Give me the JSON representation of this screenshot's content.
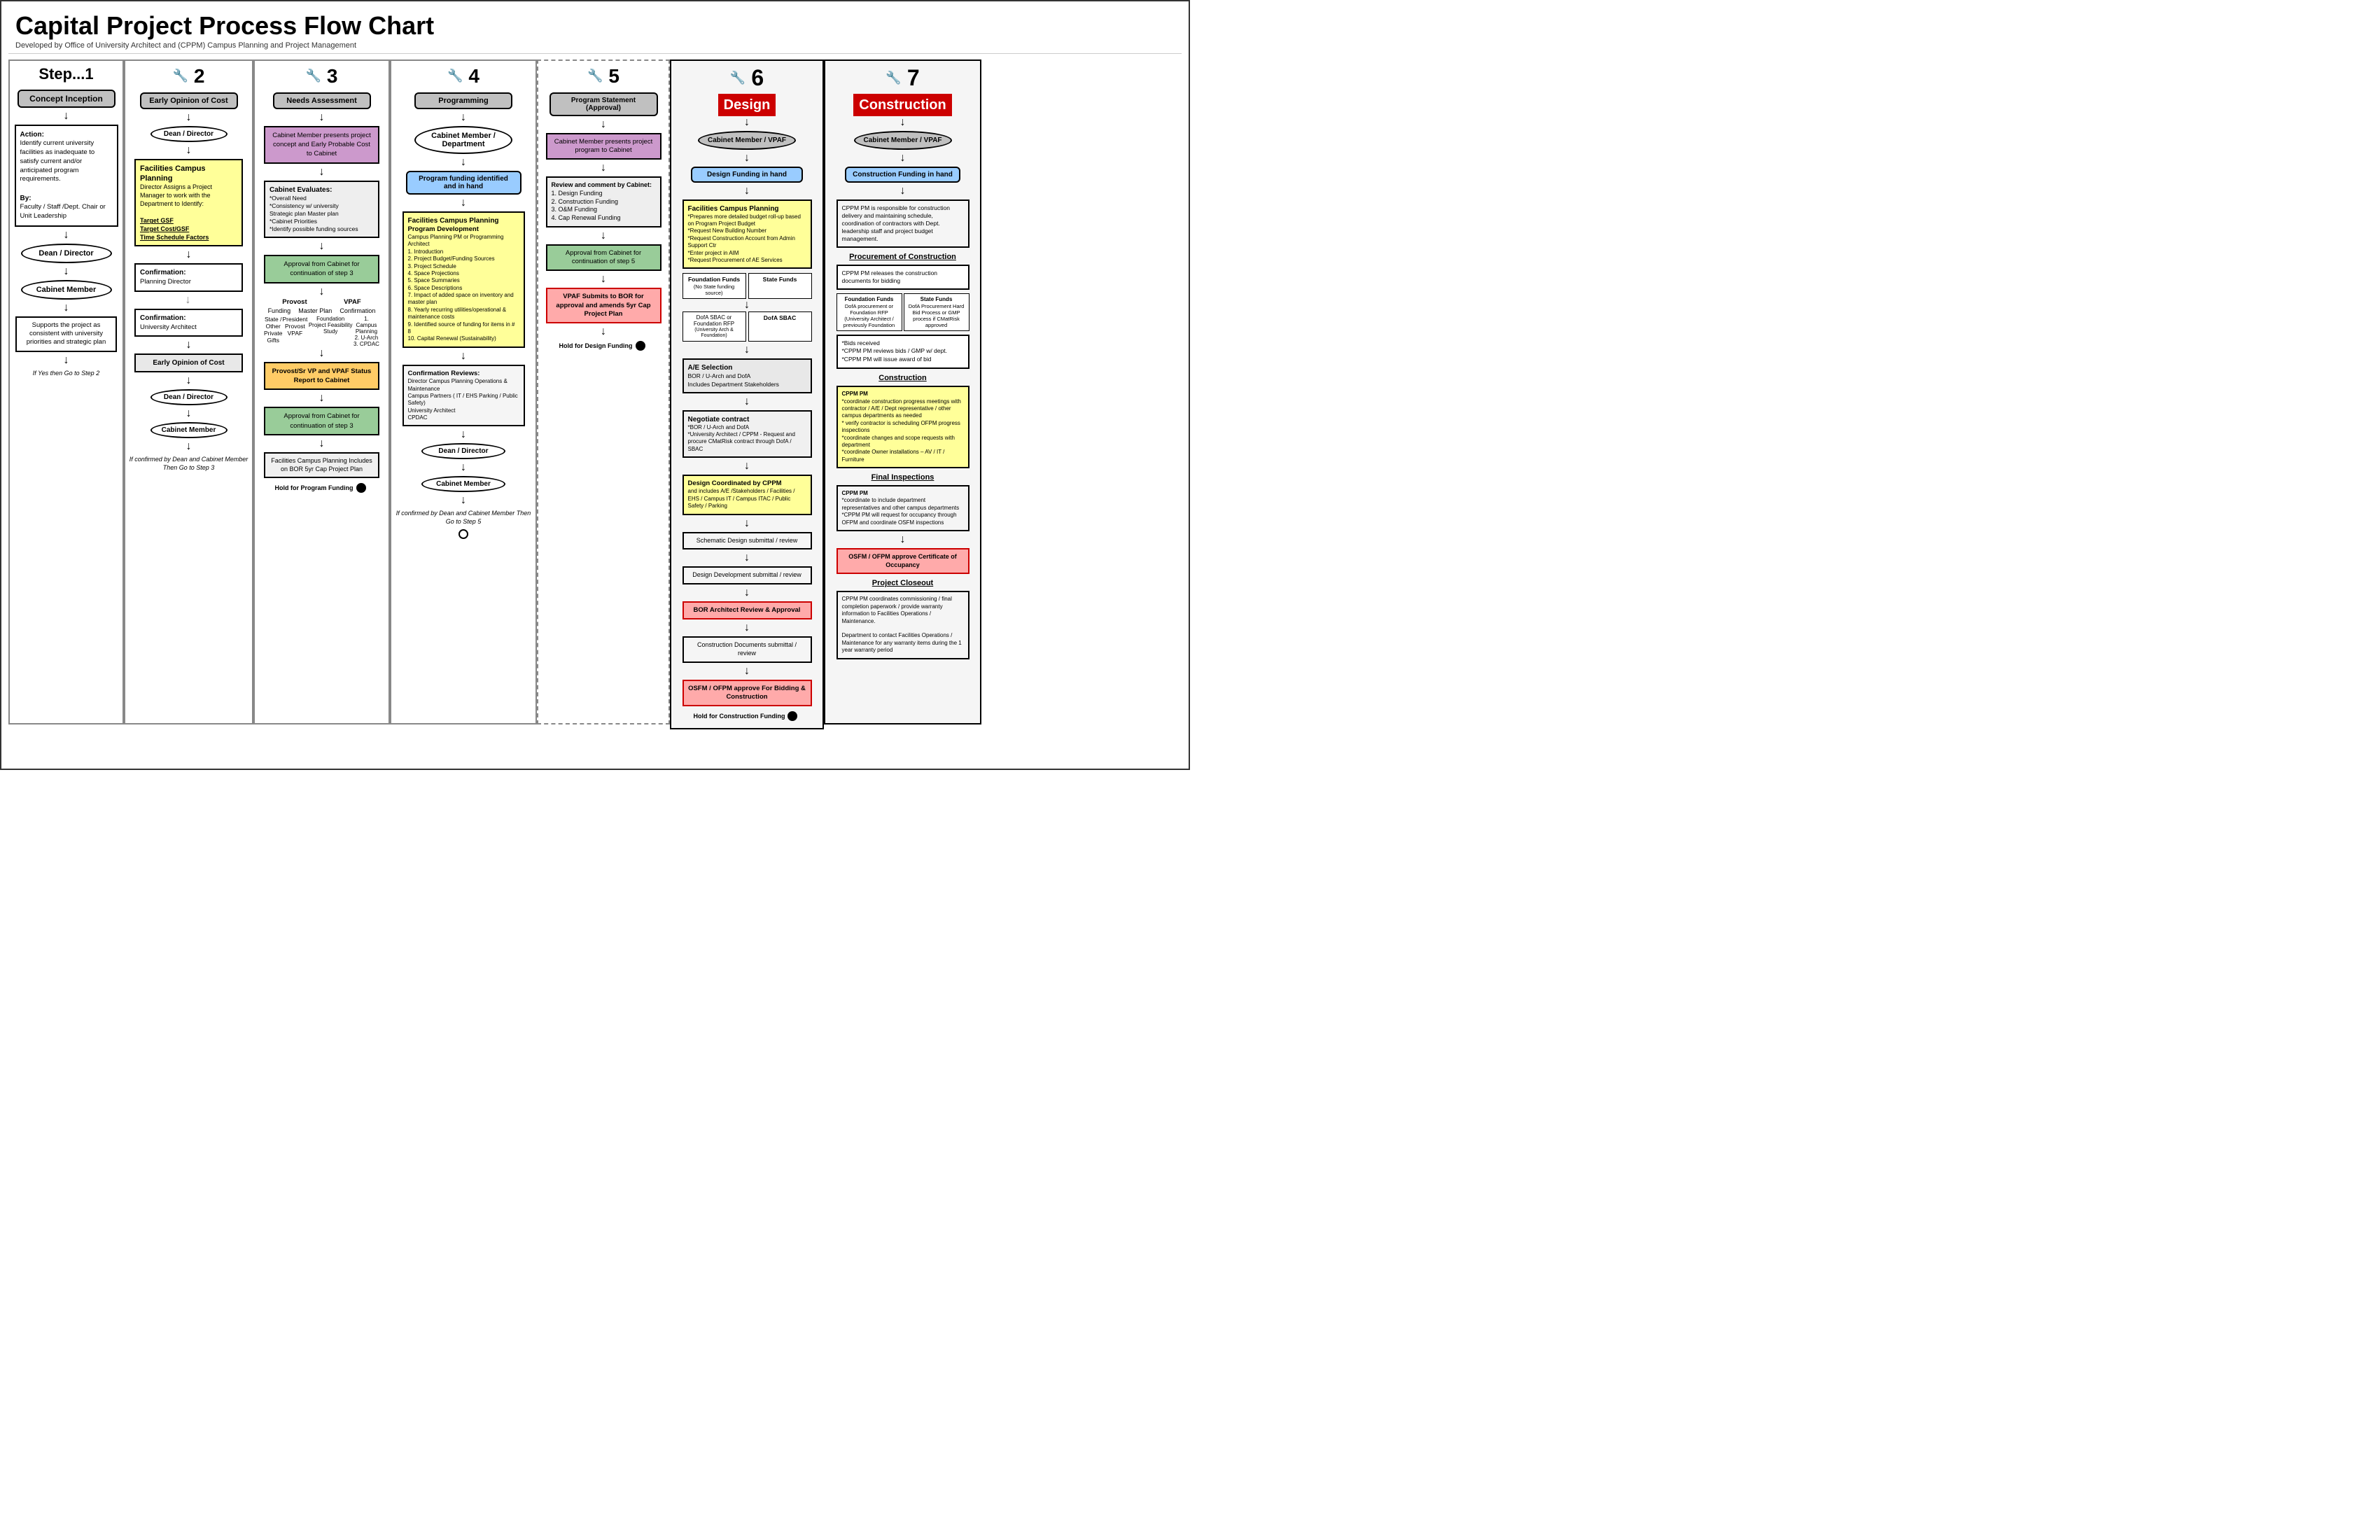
{
  "page": {
    "title": "Capital Project Process Flow Chart",
    "subtitle": "Developed by Office of University Architect and (CPPM) Campus Planning and Project Management"
  },
  "step1": {
    "label": "Step...1",
    "title": "Concept Inception",
    "action_label": "Action:",
    "action_text": "Identify current university facilities as inadequate to satisfy current and/or anticipated program requirements.",
    "by_label": "By:",
    "by_text": "Faculty / Staff /Dept. Chair or Unit Leadership",
    "oval1": "Dean / Director",
    "oval2": "Cabinet Member",
    "supports_text": "Supports the project as consistent with university priorities and strategic plan",
    "if_yes": "If Yes then Go to Step 2"
  },
  "step2": {
    "number": "2",
    "title": "Early Opinion of Cost",
    "oval1": "Dean / Director",
    "facilities_title": "Facilities Campus Planning",
    "facilities_text": "Director Assigns a Project Manager to work with the Department to Identify:",
    "target_gsf": "Target GSF",
    "target_cost": "Target Cost/GSF",
    "time_schedule": "Time Schedule Factors",
    "confirmation1_label": "Confirmation:",
    "confirmation1": "Planning Director",
    "confirmation2_label": "Confirmation:",
    "confirmation2": "University Architect",
    "early_opinion": "Early Opinion of Cost",
    "oval2": "Dean / Director",
    "oval3": "Cabinet Member",
    "if_confirmed": "If confirmed by Dean and Cabinet Member Then Go to Step 3"
  },
  "step3": {
    "number": "3",
    "title": "Needs Assessment",
    "presents_text": "Cabinet Member presents project concept and Early Probable Cost to Cabinet",
    "evaluates_title": "Cabinet Evaluates:",
    "evaluates_items": [
      "*Overall Need",
      "*Consistency w/ university Strategic plan Master plan",
      "*Cabinet Priorities",
      "*Identify possible funding sources"
    ],
    "approval1": "Approval from Cabinet for continuation of step 3",
    "provost_label": "Provost",
    "vpaf_label": "VPAF",
    "funding_label": "Funding",
    "masterplan_label": "Master Plan",
    "confirmation_label": "Confirmation",
    "state_label": "State / Other",
    "private_label": "Private Gifts",
    "president_label": "President",
    "provost2_label": "Provost",
    "vpaf2_label": "VPAF",
    "foundation_label": "Foundation Project Feasibility Study",
    "campus_planning_label": "1. Campus Planning",
    "u_arch_label": "2. U-Arch",
    "cpdac_label": "3. CPDAC",
    "status_report": "Provost/Sr VP and VPAF Status Report to Cabinet",
    "approval2": "Approval from Cabinet for continuation of step 3",
    "facilities_text": "Facilities Campus Planning Includes on BOR 5yr Cap Project Plan",
    "hold_label": "Hold for Program Funding"
  },
  "step4": {
    "number": "4",
    "title": "Programming",
    "oval1": "Cabinet Member / Department",
    "program_funding": "Program funding identified and in hand",
    "facilities_title": "Facilities Campus Planning",
    "program_dev_title": "Program Development",
    "program_dev_text": "Campus Planning PM or Programming Architect\n1. Introduction\n2. Project Budget/Funding Sources\n3. Project Schedule\n4. Space Projections\n5. Space Summaries\n6. Space Descriptions\n7. Impact of added space on inventory and master plan\n8. Yearly recurring utilities/operational & maintenance costs\n9. Identified source of funding for items in # 8\n10. Capital Renewal (Sustainability)",
    "confirmation_reviews": "Confirmation Reviews:",
    "reviews_text": "Director Campus Planning Operations & Maintenance\nCampus Partners ( IT / EHS Parking / Public Safety)\nUniversity Architect\nCPDAC",
    "oval2": "Dean / Director",
    "oval3": "Cabinet Member",
    "if_confirmed": "If confirmed by Dean and Cabinet Member Then Go to Step 5"
  },
  "step5": {
    "number": "5",
    "title": "Program Statement (Approval)",
    "oval1": "Cabinet Member presents project program to Cabinet",
    "review_title": "Review and comment by Cabinet:",
    "review_items": [
      "1. Design Funding",
      "2. Construction Funding",
      "3. O&M Funding",
      "4. Cap Renewal Funding"
    ],
    "approval_label": "Approval from Cabinet for continuation of step 5",
    "vpaf_submits": "VPAF Submits to BOR for approval and amends 5yr Cap Project Plan",
    "hold_label": "Hold for Design Funding"
  },
  "step6": {
    "number": "6",
    "title": "Design",
    "oval1": "Cabinet Member / VPAF",
    "design_funding": "Design Funding in hand",
    "facilities_title": "Facilities Campus Planning",
    "facilities_items": [
      "*Prepares more detailed budget roll-up based on Program Project Budget",
      "*Request New Building Number",
      "*Request Construction Account from Admin Support Ctr",
      "*Enter project in AIM",
      "*Request Procurement of AE Services"
    ],
    "foundation_funds": "Foundation Funds",
    "state_funds": "State Funds",
    "no_state": "(No State funding source)",
    "dofa_sbac": "DofA SBAC or Foundation RFP",
    "dofa_sbac2": "DofA SBAC",
    "university_arch": "(University Arch & Foundation)",
    "ae_selection": "A/E Selection",
    "bor_uarch": "BOR / U-Arch and DofA",
    "includes_dept": "Includes Department Stakeholders",
    "negotiate": "Negotiate contract",
    "negotiate_items": [
      "*BOR / U-Arch and DofA",
      "*University Architect / CPPM - Request and procure CMatRisk contract through DofA / SBAC"
    ],
    "design_coord": "Design Coordinated by CPPM",
    "design_coord_items": "and includes A/E /Stakeholders / Facilities / EHS / Campus IT / Campus ITAC / Public Safety / Parking",
    "schematic": "Schematic Design submittal / review",
    "design_dev": "Design Development submittal / review",
    "bor_architect": "BOR Architect Review & Approval",
    "construction_docs": "Construction Documents submittal / review",
    "osfm_ofpm": "OSFM / OFPM approve For Bidding & Construction",
    "hold_label": "Hold for Construction Funding"
  },
  "step7": {
    "number": "7",
    "title": "Construction",
    "oval1": "Cabinet Member / VPAF",
    "construction_funding": "Construction Funding in hand",
    "cppm_text": "CPPM PM is responsible for construction delivery and maintaining schedule, coordination of contractors with Dept. leadership staff and project budget management.",
    "procurement_title": "Procurement of Construction",
    "cppm_releases": "CPPM PM releases the construction documents for bidding",
    "foundation_funds": "Foundation Funds",
    "state_funds": "State Funds",
    "dofa_proc": "DofA procurement or Foundation RFP (University Architect / previously Foundation",
    "dofa_proc2": "DofA Procurement Hard Bid Process or GMP process if CMatRisk approved",
    "bids_received": "*Bids received",
    "cppm_reviews": "*CPPM PM reviews bids / GMP w/ dept.",
    "cppm_award": "*CPPM PM will issue award of bid",
    "construction_label": "Construction",
    "cppm_coord": "CPPM PM",
    "cppm_coord_items": "*coordinate construction progress meetings with contractor / A/E / Dept representative / other campus departments as needed\n* verify contractor is scheduling OFPM progress inspections\n*coordinate changes and scope requests with department\n*coordinate Owner installations – AV / IT / Furniture",
    "final_inspections": "Final Inspections",
    "cppm_final": "CPPM PM",
    "cppm_final_items": "*coordinate to include department representatives and other campus departments\n*CPPM PM will request for occupancy through OFPM and coordinate OSFM inspections",
    "osfm_approve": "OSFM / OFPM approve Certificate of Occupancy",
    "project_closeout": "Project Closeout",
    "cppm_closeout": "CPPM PM coordinates commissioning / final completion paperwork / provide warranty information to Facilities Operations / Maintenance.",
    "dept_contact": "Department to contact Facilities Operations / Maintenance for any warranty items during the 1 year warranty period"
  }
}
